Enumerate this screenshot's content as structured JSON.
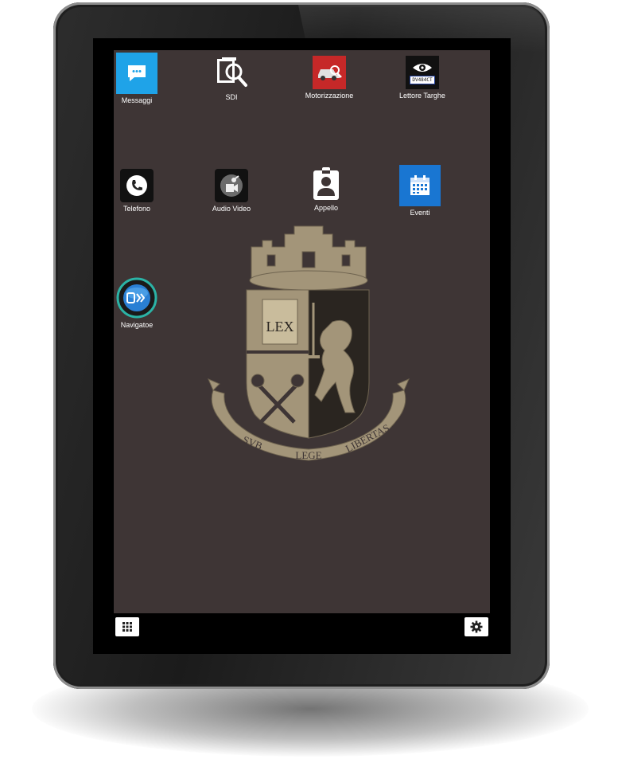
{
  "apps": [
    {
      "id": "messaggi",
      "label": "Messaggi",
      "icon": "chat-icon"
    },
    {
      "id": "sdi",
      "label": "SDI",
      "icon": "document-search-icon"
    },
    {
      "id": "motorizzazione",
      "label": "Motorizzazione",
      "icon": "car-search-icon"
    },
    {
      "id": "lettore-targhe",
      "label": "Lettore Targhe",
      "icon": "eye-plate-icon",
      "plate": "DV484CT"
    },
    {
      "id": "telefono",
      "label": "Telefono",
      "icon": "phone-icon"
    },
    {
      "id": "audio-video",
      "label": "Audio Video",
      "icon": "media-icon"
    },
    {
      "id": "appello",
      "label": "Appello",
      "icon": "badge-person-icon"
    },
    {
      "id": "eventi",
      "label": "Eventi",
      "icon": "calendar-icon"
    },
    {
      "id": "navigatoe",
      "label": "Navigatoe",
      "icon": "navigation-icon"
    }
  ],
  "emblem": {
    "book_text": "LEX",
    "motto": [
      "SVB",
      "LEGE",
      "LIBERTAS"
    ],
    "color": "#a39579"
  },
  "navbar": {
    "left_icon": "app-grid-icon",
    "right_icon": "settings-gear-icon"
  },
  "colors": {
    "wallpaper": "#3e3535",
    "messaggi": "#1fa3e8",
    "motorizzazione": "#c62828",
    "eventi": "#1976d2"
  }
}
